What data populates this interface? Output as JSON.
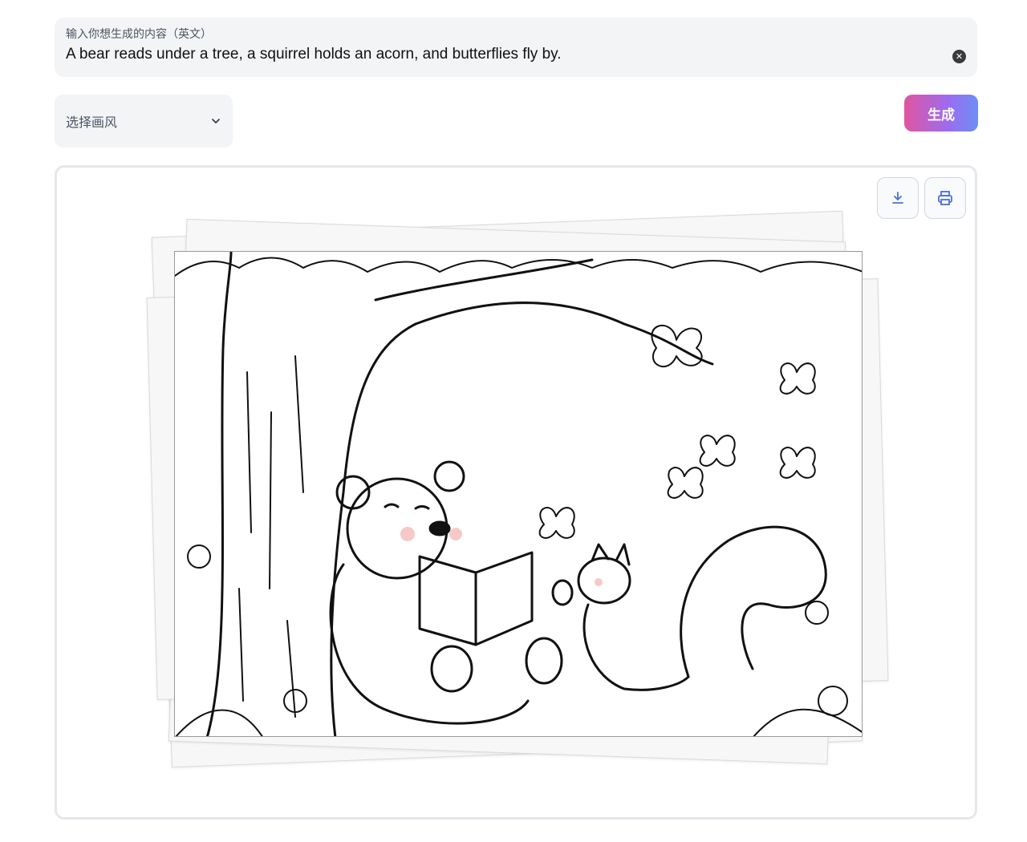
{
  "prompt": {
    "label": "输入你想生成的内容（英文）",
    "value": "A bear reads under a tree, a squirrel holds an acorn, and butterflies fly by.",
    "clear_icon": "close-circle-icon"
  },
  "style_select": {
    "label": "选择画风",
    "icon": "chevron-down-icon"
  },
  "generate": {
    "label": "生成"
  },
  "toolbar": {
    "download_icon": "download-icon",
    "print_icon": "printer-icon"
  },
  "image": {
    "description_icon": "coloring-page-illustration"
  },
  "colors": {
    "accent_start": "#e0559f",
    "accent_end": "#6c8ff5",
    "field_bg": "#f3f4f6"
  }
}
